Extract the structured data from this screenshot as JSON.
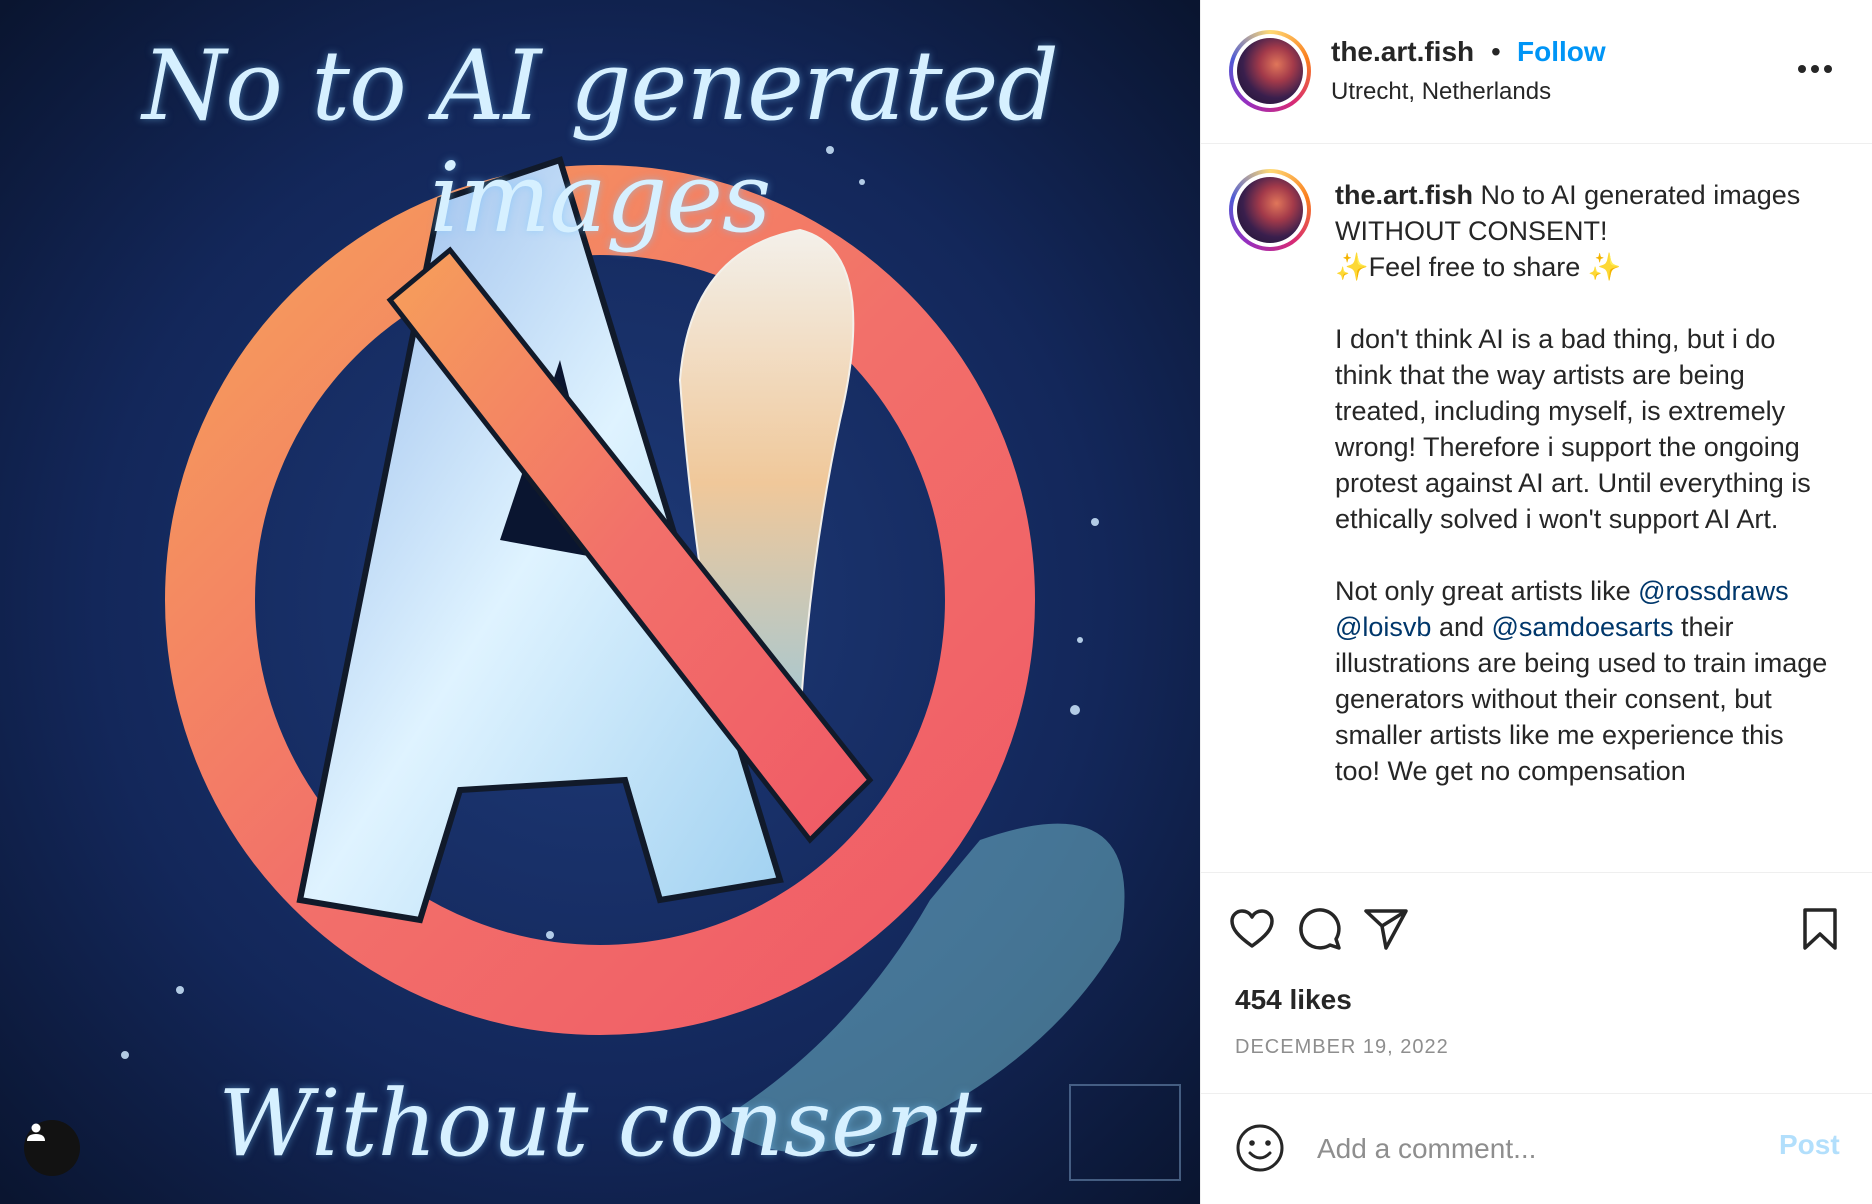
{
  "artwork": {
    "title_top": "No to AI generated images",
    "title_bottom": "Without consent"
  },
  "header": {
    "username": "the.art.fish",
    "separator": "•",
    "follow_label": "Follow",
    "location": "Utrecht, Netherlands",
    "more_icon": "more-horizontal-icon"
  },
  "caption": {
    "username": "the.art.fish",
    "line1": " No to AI generated images WITHOUT CONSENT!",
    "line2": "✨Feel free to share ✨",
    "para1": "I don't think AI is a bad thing, but i do think that the way artists are being treated, including myself, is extremely wrong! Therefore i support the ongoing protest against AI art. Until everything is ethically solved i won't support AI Art.",
    "para2_start": "Not only great artists like ",
    "mention1": "@rossdraws",
    "mention2": "@loisvb",
    "and_text": " and ",
    "mention3": "@samdoesarts",
    "para2_end": " their illustrations are being used to train image generators without their consent, but smaller artists like me experience this too! We get no compensation"
  },
  "actions": {
    "like_icon": "heart-icon",
    "comment_icon": "comment-icon",
    "share_icon": "send-icon",
    "save_icon": "bookmark-icon",
    "likes": "454 likes",
    "date": "DECEMBER 19, 2022"
  },
  "comment_box": {
    "placeholder": "Add a comment...",
    "post_label": "Post"
  }
}
